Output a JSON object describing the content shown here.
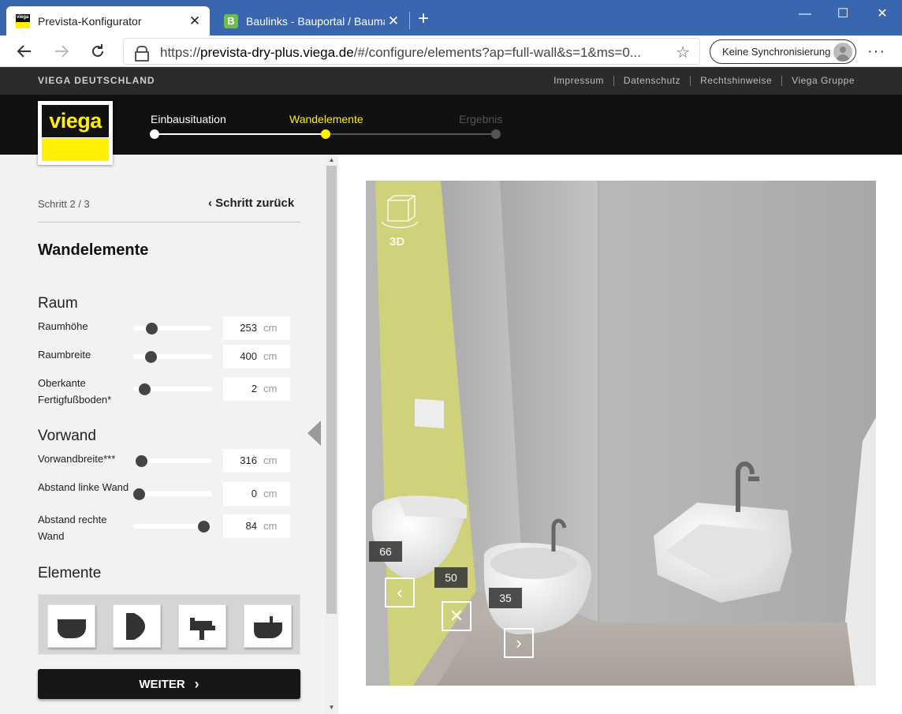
{
  "browser": {
    "tabs": [
      {
        "title": "Prevista-Konfigurator",
        "active": true
      },
      {
        "title": "Baulinks - Bauportal / Baumagazin",
        "active": false
      }
    ],
    "url_prefix": "https://",
    "url_domain": "prevista-dry-plus.viega.de",
    "url_rest": "/#/configure/elements?ap=full-wall&s=1&ms=0...",
    "sync_label": "Keine Synchronisierung"
  },
  "topbar": {
    "brand": "VIEGA DEUTSCHLAND",
    "links": [
      "Impressum",
      "Datenschutz",
      "Rechtshinweise",
      "Viega Gruppe"
    ]
  },
  "header": {
    "logo_text": "viega",
    "steps": [
      {
        "label": "Einbausituation",
        "state": "done"
      },
      {
        "label": "Wandelemente",
        "state": "active"
      },
      {
        "label": "Ergebnis",
        "state": "pending"
      }
    ],
    "accent_color": "#ffef00"
  },
  "panel": {
    "step_counter": "Schritt 2 / 3",
    "back_label": "Schritt zurück",
    "title": "Wandelemente",
    "raum": {
      "heading": "Raum",
      "params": [
        {
          "label": "Raumhöhe",
          "value": "253",
          "unit": "cm",
          "slider": 0.24
        },
        {
          "label": "Raumbreite",
          "value": "400",
          "unit": "cm",
          "slider": 0.23
        },
        {
          "label": "Oberkante Fertigfußboden*",
          "value": "2",
          "unit": "cm",
          "slider": 0.15
        }
      ]
    },
    "vorwand": {
      "heading": "Vorwand",
      "params": [
        {
          "label": "Vorwandbreite***",
          "value": "316",
          "unit": "cm",
          "slider": 0.12
        },
        {
          "label": "Abstand linke Wand",
          "value": "0",
          "unit": "cm",
          "slider": 0.08
        },
        {
          "label": "Abstand rechte Wand",
          "value": "84",
          "unit": "cm",
          "slider": 0.9
        }
      ]
    },
    "elemente": {
      "heading": "Elemente",
      "items": [
        "wc-icon",
        "urinal-icon",
        "washbasin-icon",
        "bidet-icon"
      ]
    },
    "next_label": "WEITER"
  },
  "viewer": {
    "mode_label": "3D",
    "measurements": [
      "66",
      "50",
      "35"
    ]
  }
}
